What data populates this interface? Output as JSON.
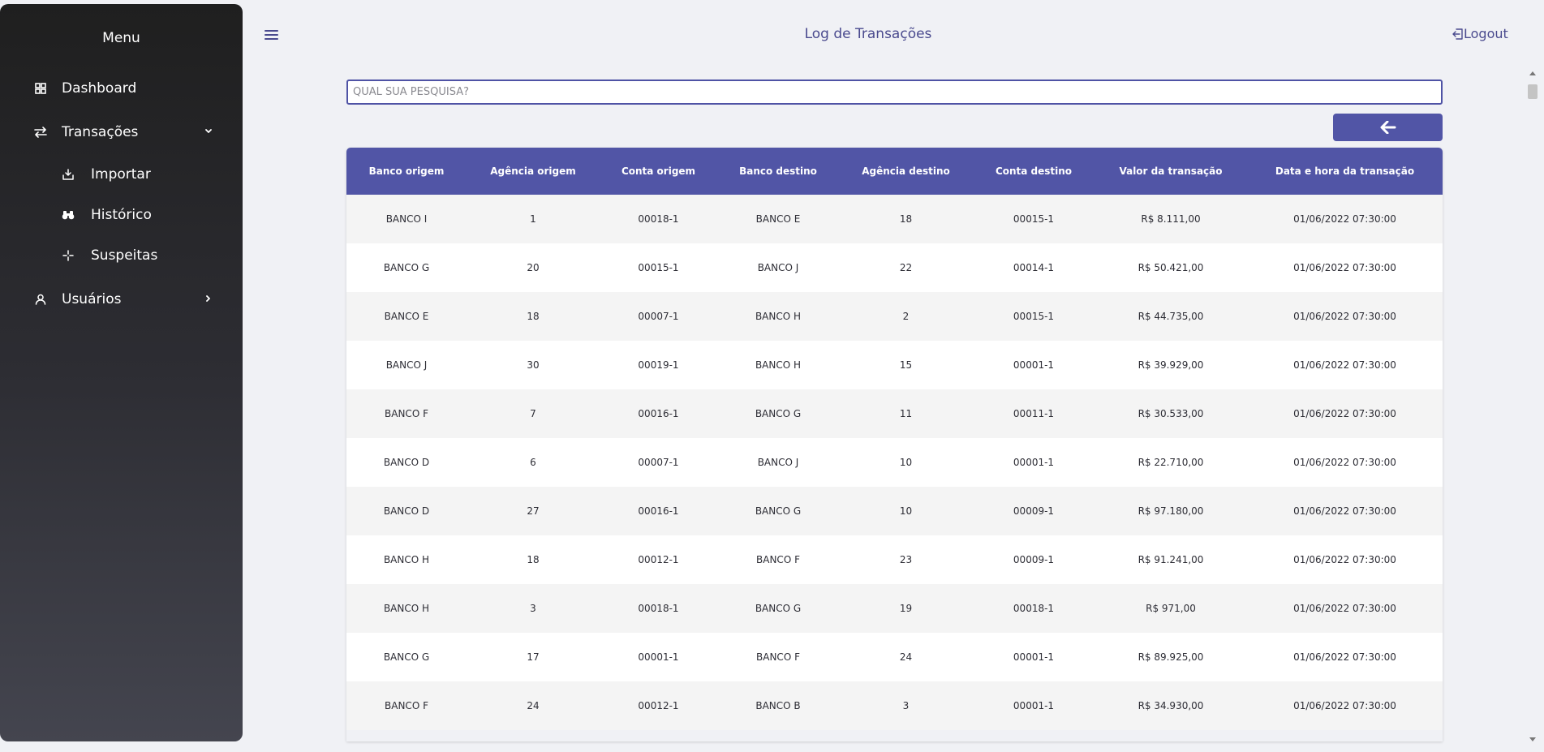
{
  "sidebar": {
    "title": "Menu",
    "items": [
      {
        "label": "Dashboard",
        "icon": "grid-icon"
      },
      {
        "label": "Transações",
        "icon": "arrows-swap-icon"
      },
      {
        "label": "Importar",
        "icon": "import-icon"
      },
      {
        "label": "Histórico",
        "icon": "binoculars-icon"
      },
      {
        "label": "Suspeitas",
        "icon": "crosshair-icon"
      },
      {
        "label": "Usuários",
        "icon": "user-icon"
      }
    ]
  },
  "header": {
    "title": "Log de Transações",
    "logout_label": "Logout"
  },
  "search": {
    "placeholder": "QUAL SUA PESQUISA?",
    "value": ""
  },
  "back_button": {
    "icon": "arrow-left-icon"
  },
  "table": {
    "columns": [
      "Banco origem",
      "Agência origem",
      "Conta origem",
      "Banco destino",
      "Agência destino",
      "Conta destino",
      "Valor da transação",
      "Data e hora da transação"
    ],
    "rows": [
      [
        "BANCO I",
        "1",
        "00018-1",
        "BANCO E",
        "18",
        "00015-1",
        "R$ 8.111,00",
        "01/06/2022 07:30:00"
      ],
      [
        "BANCO G",
        "20",
        "00015-1",
        "BANCO J",
        "22",
        "00014-1",
        "R$ 50.421,00",
        "01/06/2022 07:30:00"
      ],
      [
        "BANCO E",
        "18",
        "00007-1",
        "BANCO H",
        "2",
        "00015-1",
        "R$ 44.735,00",
        "01/06/2022 07:30:00"
      ],
      [
        "BANCO J",
        "30",
        "00019-1",
        "BANCO H",
        "15",
        "00001-1",
        "R$ 39.929,00",
        "01/06/2022 07:30:00"
      ],
      [
        "BANCO F",
        "7",
        "00016-1",
        "BANCO G",
        "11",
        "00011-1",
        "R$ 30.533,00",
        "01/06/2022 07:30:00"
      ],
      [
        "BANCO D",
        "6",
        "00007-1",
        "BANCO J",
        "10",
        "00001-1",
        "R$ 22.710,00",
        "01/06/2022 07:30:00"
      ],
      [
        "BANCO D",
        "27",
        "00016-1",
        "BANCO G",
        "10",
        "00009-1",
        "R$ 97.180,00",
        "01/06/2022 07:30:00"
      ],
      [
        "BANCO H",
        "18",
        "00012-1",
        "BANCO F",
        "23",
        "00009-1",
        "R$ 91.241,00",
        "01/06/2022 07:30:00"
      ],
      [
        "BANCO H",
        "3",
        "00018-1",
        "BANCO G",
        "19",
        "00018-1",
        "R$ 971,00",
        "01/06/2022 07:30:00"
      ],
      [
        "BANCO G",
        "17",
        "00001-1",
        "BANCO F",
        "24",
        "00001-1",
        "R$ 89.925,00",
        "01/06/2022 07:30:00"
      ],
      [
        "BANCO F",
        "24",
        "00012-1",
        "BANCO B",
        "3",
        "00001-1",
        "R$ 34.930,00",
        "01/06/2022 07:30:00"
      ]
    ]
  },
  "colors": {
    "accent": "#5155a6",
    "title_text": "#4a4a8e",
    "sidebar_top": "#1f1f1f",
    "sidebar_bottom": "#44454f"
  }
}
